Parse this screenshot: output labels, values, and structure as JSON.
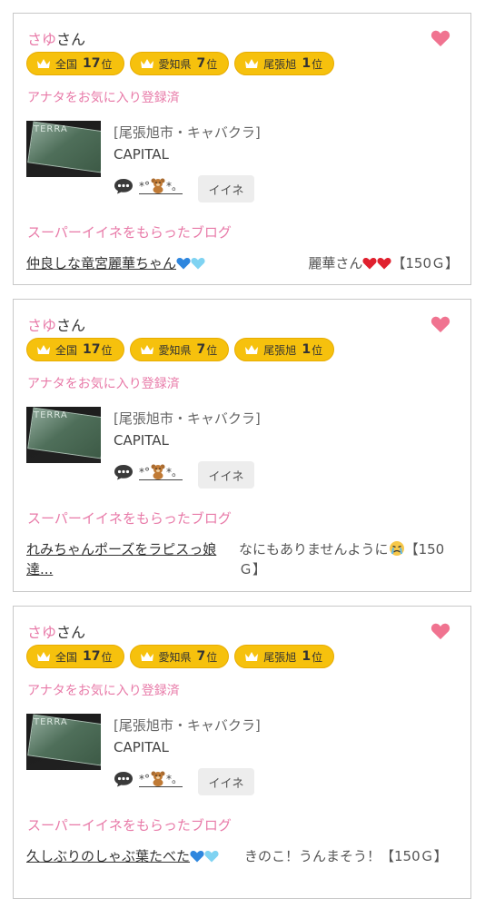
{
  "colors": {
    "accent_pink": "#e87aa8",
    "badge_gold": "#f6c10d",
    "heart_pink": "#f07390"
  },
  "cards": [
    {
      "user_name": "さゆ",
      "user_suffix": "さん",
      "rank_national_label": "全国",
      "rank_national_value": "17",
      "rank_pref_label": "愛知県",
      "rank_pref_value": "7",
      "rank_city_label": "尾張旭",
      "rank_city_value": "1",
      "rank_unit": "位",
      "favorite_status": "アナタをお気に入り登録済",
      "category": "[尾張旭市・キャバクラ]",
      "shop_name": "CAPITAL",
      "thumb_text": "TERRA",
      "deco_left": "*°",
      "deco_right": "*。",
      "iine_label": "イイネ",
      "super_title": "スーパーイイネをもらったブログ",
      "blog_title": "仲良しな竜宮麗華ちゃん",
      "comment_text": "麗華さん",
      "comment_points": "【150Ｇ】",
      "heart_icons": [
        "blue-heart-icon",
        "light-blue-heart-icon"
      ],
      "comment_icons": [
        "red-heart-icon",
        "red-heart-icon"
      ]
    },
    {
      "user_name": "さゆ",
      "user_suffix": "さん",
      "rank_national_label": "全国",
      "rank_national_value": "17",
      "rank_pref_label": "愛知県",
      "rank_pref_value": "7",
      "rank_city_label": "尾張旭",
      "rank_city_value": "1",
      "rank_unit": "位",
      "favorite_status": "アナタをお気に入り登録済",
      "category": "[尾張旭市・キャバクラ]",
      "shop_name": "CAPITAL",
      "thumb_text": "TERRA",
      "deco_left": "*°",
      "deco_right": "*。",
      "iine_label": "イイネ",
      "super_title": "スーパーイイネをもらったブログ",
      "blog_title": "れみちゃんポーズをラピスっ娘達...",
      "comment_text": "なにもありませんように",
      "comment_points": "【150Ｇ】",
      "comment_icons": [
        "crying-face-icon"
      ]
    },
    {
      "user_name": "さゆ",
      "user_suffix": "さん",
      "rank_national_label": "全国",
      "rank_national_value": "17",
      "rank_pref_label": "愛知県",
      "rank_pref_value": "7",
      "rank_city_label": "尾張旭",
      "rank_city_value": "1",
      "rank_unit": "位",
      "favorite_status": "アナタをお気に入り登録済",
      "category": "[尾張旭市・キャバクラ]",
      "shop_name": "CAPITAL",
      "thumb_text": "TERRA",
      "deco_left": "*°",
      "deco_right": "*。",
      "iine_label": "イイネ",
      "super_title": "スーパーイイネをもらったブログ",
      "blog_title": "久しぶりのしゃぶ葉たべた",
      "comment_text": "きのこ！うんまそう！",
      "comment_points": "【150Ｇ】",
      "heart_icons": [
        "blue-heart-icon",
        "light-blue-heart-icon"
      ]
    }
  ]
}
